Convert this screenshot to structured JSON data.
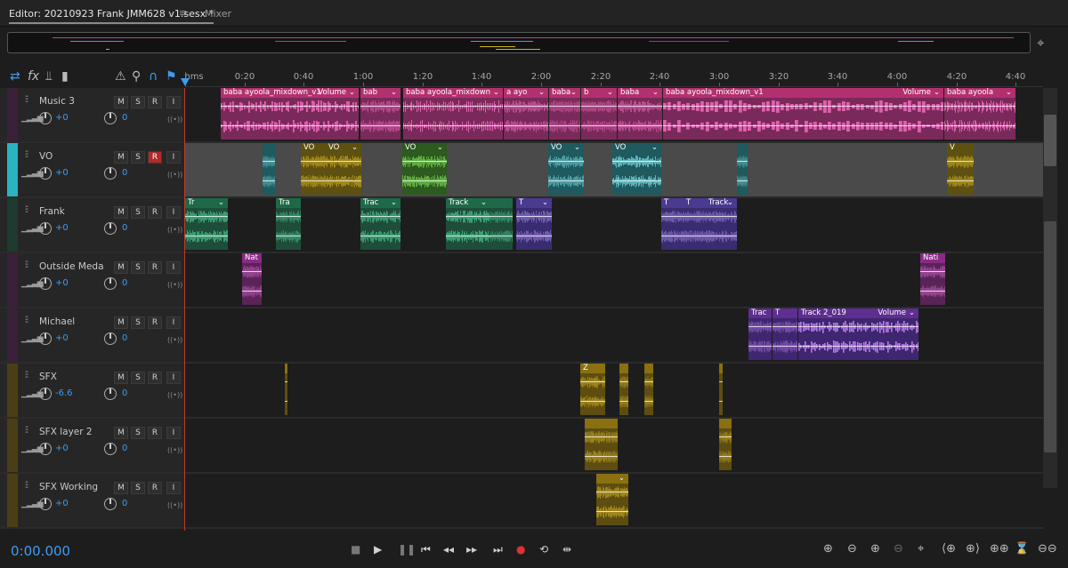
{
  "tabs": {
    "editor": "Editor: 20210923 Frank JMM628 v1.sesx *",
    "menu_icon": "≡",
    "mixer": "Mixer"
  },
  "ruler": {
    "ticks": [
      "hms",
      "0:20",
      "0:40",
      "1:00",
      "1:20",
      "1:40",
      "2:00",
      "2:20",
      "2:40",
      "3:00",
      "3:20",
      "3:40",
      "4:00",
      "4:20",
      "4:40"
    ]
  },
  "buttons": {
    "mute": "M",
    "solo": "S",
    "record": "R",
    "input": "I"
  },
  "tracks": [
    {
      "name": "Music 3",
      "volume": "+0",
      "pan": "0",
      "color": "#c2408c"
    },
    {
      "name": "VO",
      "volume": "+0",
      "pan": "0",
      "color": "#2bb3c0",
      "armed": true
    },
    {
      "name": "Frank",
      "volume": "+0",
      "pan": "0",
      "color": "#2f8a5e"
    },
    {
      "name": "Outside Meda",
      "volume": "+0",
      "pan": "0",
      "color": "#a23a9b"
    },
    {
      "name": "Michael",
      "volume": "+0",
      "pan": "0",
      "color": "#7a3fb5"
    },
    {
      "name": "SFX",
      "volume": "-6.6",
      "pan": "0",
      "color": "#a88a15"
    },
    {
      "name": "SFX layer 2",
      "volume": "+0",
      "pan": "0",
      "color": "#a88a15"
    },
    {
      "name": "SFX Working",
      "volume": "+0",
      "pan": "0",
      "color": "#a88a15"
    }
  ],
  "clip_labels": {
    "music": [
      "baba ayoola_mixdown_v1",
      "bab",
      "baba ayoola_mixdown",
      "a ayo",
      "baba",
      "b",
      "baba",
      "baba ayoola_mixdown_v1",
      "baba ayoola"
    ],
    "music_volume": "Volume",
    "vo": [
      "VO",
      "VO",
      "VO",
      "VO",
      "VO",
      "",
      "V"
    ],
    "frank": [
      "Tr",
      "Tra",
      "Trac",
      "Track",
      "T",
      "T",
      "T",
      "Track"
    ],
    "outside": [
      "Nat",
      "Nati"
    ],
    "michael": [
      "Trac",
      "T",
      "Track 2_019"
    ],
    "sfx": [
      "Z"
    ],
    "sfx_working": [
      ""
    ]
  },
  "transport": {
    "time": "0:00.000"
  },
  "colors": {
    "accent": "#3d9cf2",
    "playhead": "#c0392b",
    "record": "#e03030"
  }
}
